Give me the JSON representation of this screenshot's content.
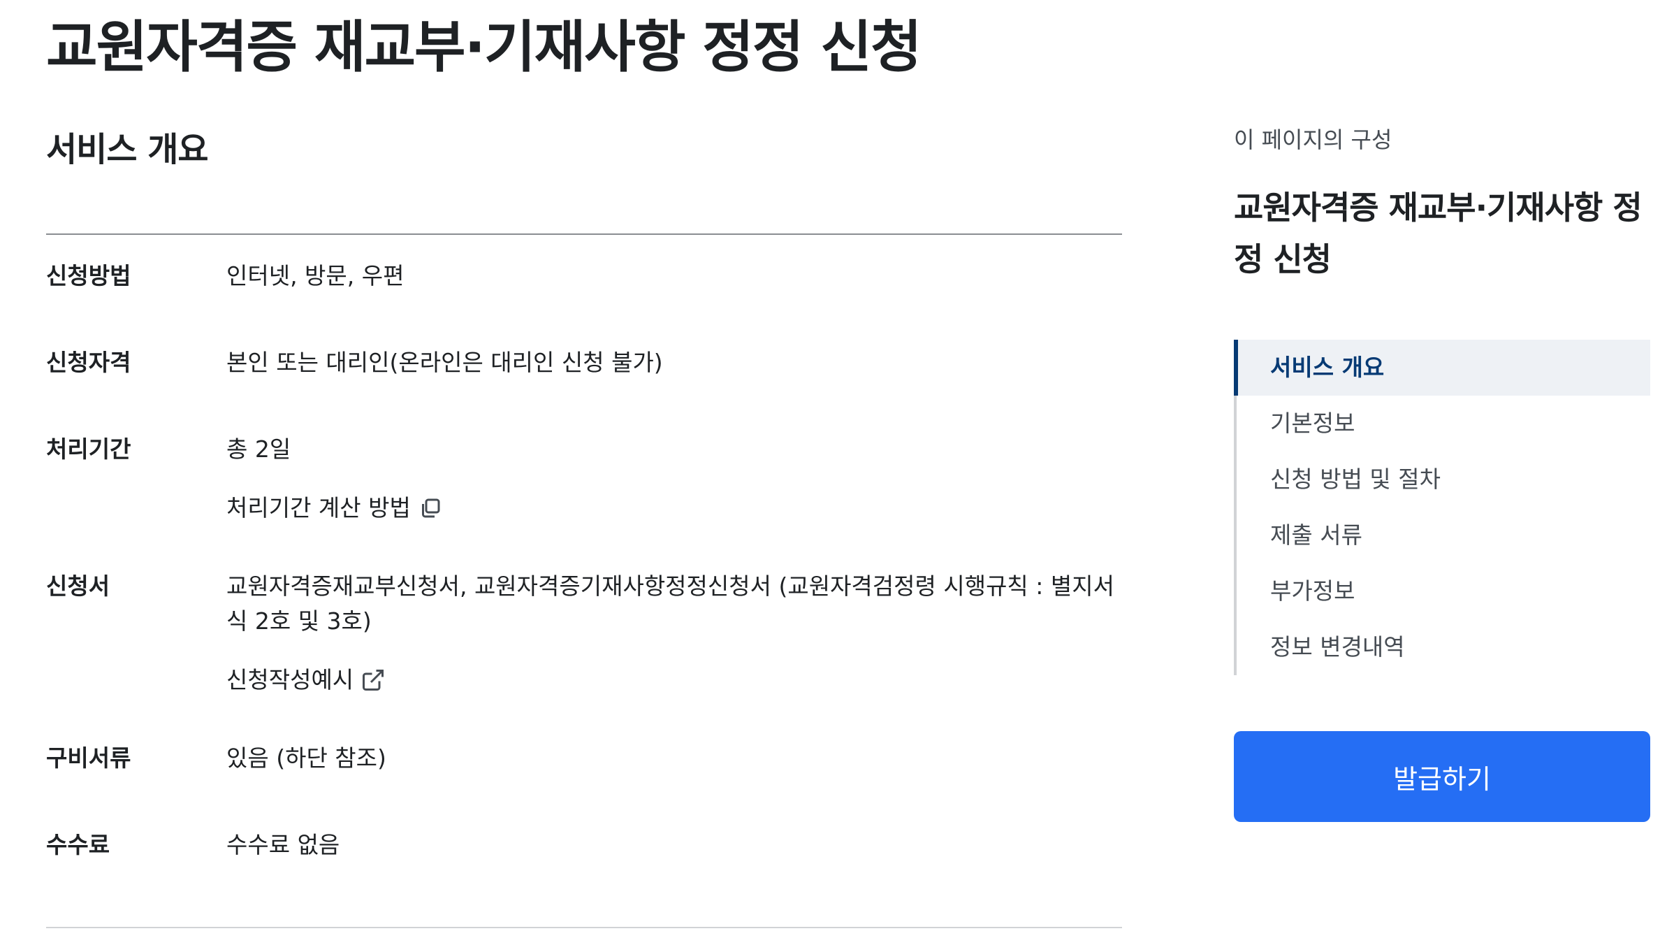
{
  "page_title": "교원자격증 재교부·기재사항 정정 신청",
  "overview": {
    "title": "서비스 개요",
    "rows": [
      {
        "label": "신청방법",
        "value": "인터넷, 방문, 우편"
      },
      {
        "label": "신청자격",
        "value": "본인 또는 대리인(온라인은 대리인 신청 불가)"
      },
      {
        "label": "처리기간",
        "value": "총 2일",
        "link": "처리기간 계산 방법",
        "link_icon": "copy-icon"
      },
      {
        "label": "신청서",
        "value": "교원자격증재교부신청서, 교원자격증기재사항정정신청서 (교원자격검정령 시행규칙 : 별지서식 2호 및 3호)",
        "link": "신청작성예시",
        "link_icon": "external-link-icon"
      },
      {
        "label": "구비서류",
        "value": "있음 (하단 참조)"
      },
      {
        "label": "수수료",
        "value": "수수료 없음"
      }
    ]
  },
  "sidebar": {
    "caption": "이 페이지의 구성",
    "title": "교원자격증 재교부·기재사항 정정 신청",
    "items": [
      {
        "label": "서비스 개요",
        "active": true
      },
      {
        "label": "기본정보",
        "active": false
      },
      {
        "label": "신청 방법 및 절차",
        "active": false
      },
      {
        "label": "제출 서류",
        "active": false
      },
      {
        "label": "부가정보",
        "active": false
      },
      {
        "label": "정보 변경내역",
        "active": false
      }
    ],
    "button_label": "발급하기"
  },
  "colors": {
    "text": "#1e2124",
    "active_nav": "#063a74",
    "active_nav_bg": "#eef1f5",
    "button": "#256ef4"
  }
}
